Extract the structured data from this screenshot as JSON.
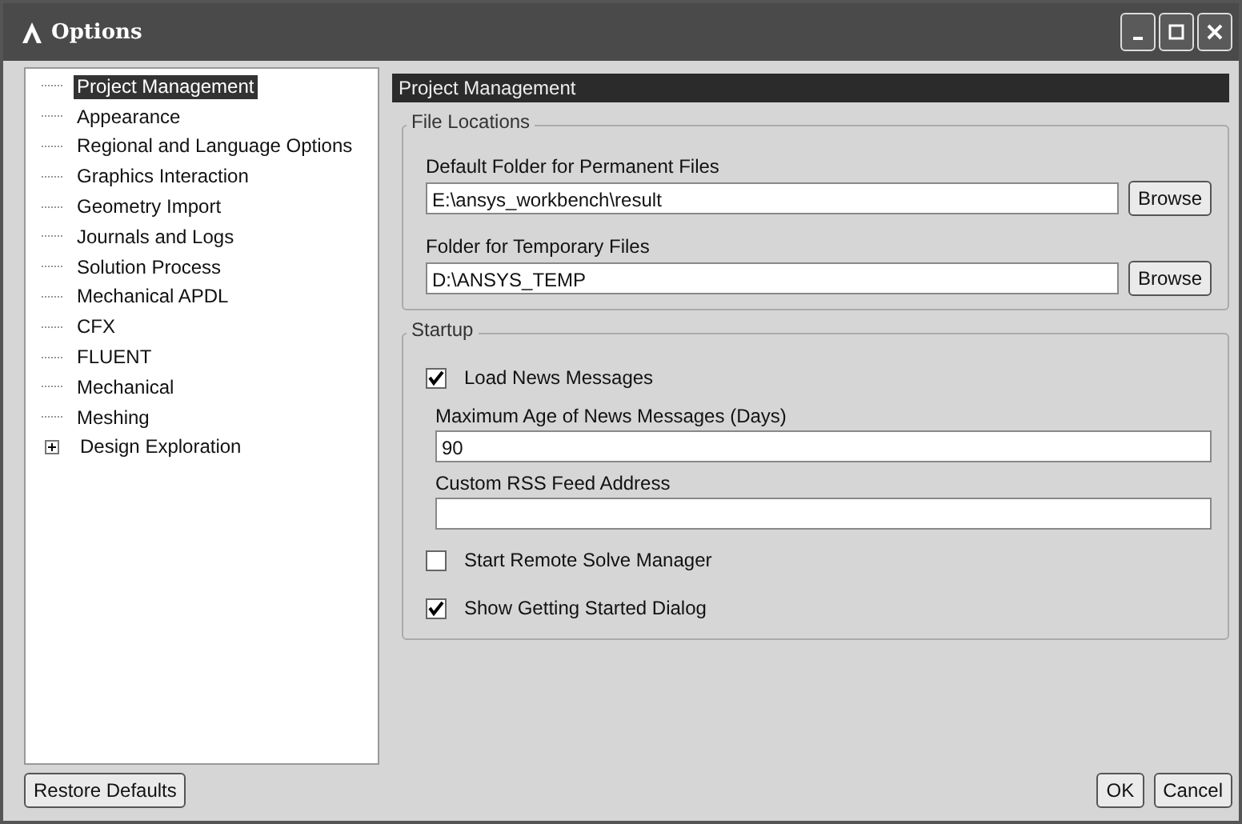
{
  "window": {
    "title": "Options"
  },
  "tree": {
    "items": [
      {
        "label": "Project Management",
        "selected": true,
        "expandable": false
      },
      {
        "label": "Appearance",
        "selected": false,
        "expandable": false
      },
      {
        "label": "Regional and Language Options",
        "selected": false,
        "expandable": false
      },
      {
        "label": "Graphics Interaction",
        "selected": false,
        "expandable": false
      },
      {
        "label": "Geometry Import",
        "selected": false,
        "expandable": false
      },
      {
        "label": "Journals and Logs",
        "selected": false,
        "expandable": false
      },
      {
        "label": "Solution Process",
        "selected": false,
        "expandable": false
      },
      {
        "label": "Mechanical APDL",
        "selected": false,
        "expandable": false
      },
      {
        "label": "CFX",
        "selected": false,
        "expandable": false
      },
      {
        "label": "FLUENT",
        "selected": false,
        "expandable": false
      },
      {
        "label": "Mechanical",
        "selected": false,
        "expandable": false
      },
      {
        "label": "Meshing",
        "selected": false,
        "expandable": false
      },
      {
        "label": "Design Exploration",
        "selected": false,
        "expandable": true
      }
    ]
  },
  "panel": {
    "title": "Project Management",
    "groups": [
      {
        "title": "File Locations",
        "items": [
          {
            "kind": "path",
            "label": "Default Folder for Permanent Files",
            "value": "E:\\ansys_workbench\\result",
            "button": "Browse"
          },
          {
            "kind": "path",
            "label": "Folder for Temporary Files",
            "value": "D:\\ANSYS_TEMP",
            "button": "Browse"
          }
        ]
      },
      {
        "title": "Startup",
        "items": [
          {
            "kind": "checkbox",
            "label": "Load News Messages",
            "checked": true
          },
          {
            "kind": "field",
            "label": "Maximum Age of News Messages (Days)",
            "value": "90"
          },
          {
            "kind": "field",
            "label": "Custom RSS Feed Address"
          },
          {
            "kind": "checkbox",
            "label": "Start Remote Solve Manager",
            "checked": false
          },
          {
            "kind": "checkbox",
            "label": "Show Getting Started Dialog",
            "checked": true
          }
        ]
      }
    ]
  },
  "footer": {
    "left_button": "Restore Defaults",
    "buttons": [
      "OK",
      "Cancel"
    ]
  }
}
